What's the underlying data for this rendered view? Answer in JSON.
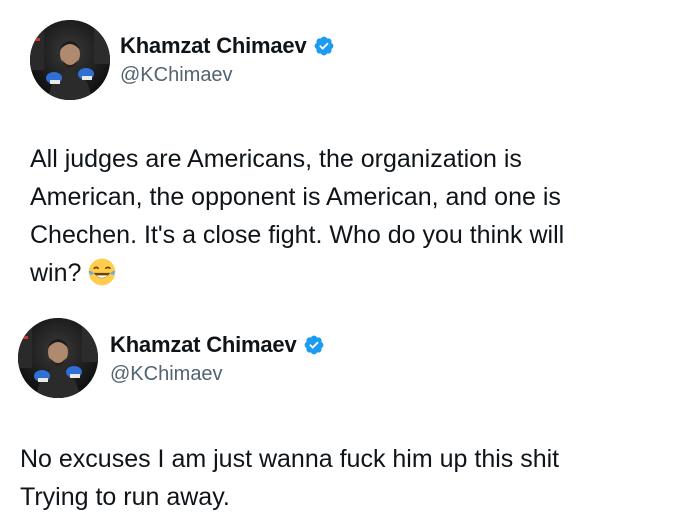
{
  "tweets": [
    {
      "display_name": "Khamzat Chimaev",
      "handle": "@KChimaev",
      "verified": true,
      "text_lines": [
        "All judges are Americans, the organization is",
        "American, the opponent is American, and one is",
        "Chechen. It's a close fight. Who do you think will",
        "win?"
      ],
      "emoji": "face-with-tears-of-joy"
    },
    {
      "display_name": "Khamzat Chimaev",
      "handle": "@KChimaev",
      "verified": true,
      "text_lines": [
        "No excuses I am just wanna fuck him up this shit",
        "Trying to run away."
      ]
    }
  ],
  "colors": {
    "text": "#0f1419",
    "handle": "#536471",
    "verified_badge": "#1d9bf0",
    "background": "#ffffff"
  }
}
